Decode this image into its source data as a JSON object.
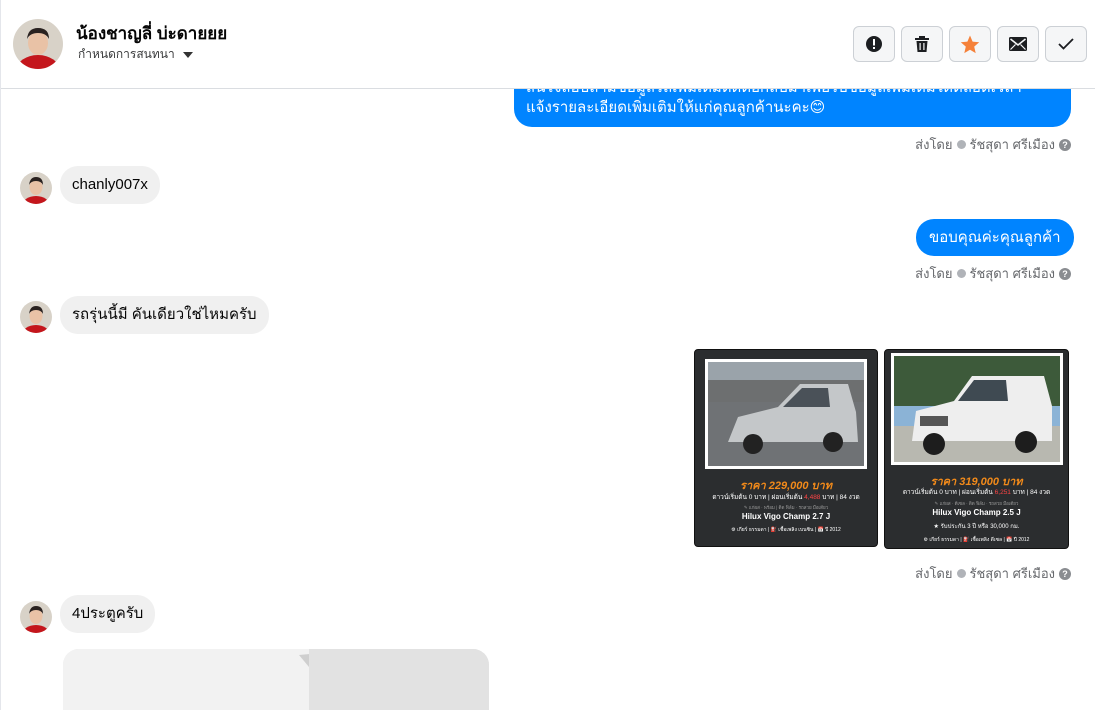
{
  "header": {
    "contact_name": "น้องชาญลี่ บ่ะดายยย",
    "assign_label": "กำหนดการสนทนา",
    "actions": [
      {
        "name": "spam-report-button",
        "icon": "exclamation-icon"
      },
      {
        "name": "delete-button",
        "icon": "trash-icon"
      },
      {
        "name": "star-button",
        "icon": "star-icon"
      },
      {
        "name": "mark-unread-button",
        "icon": "envelope-icon"
      },
      {
        "name": "mark-done-button",
        "icon": "check-icon"
      }
    ],
    "star_color": "#f5813a"
  },
  "messages": {
    "out_1": {
      "line1": "สนใจสอบถามขอมูลรถเพิ่มเติมติดตอกลับมาเพื่อรับขอมูลเพิ่มเติมไดตลอดเวลา",
      "line2": "แจ้งรายละเอียดเพิ่มเติมให้แก่คุณลูกค้านะคะ😊",
      "sent_by_label": "ส่งโดย",
      "sender": "รัชสุดา ศรีเมือง"
    },
    "in_1": "chanly007x",
    "out_2": {
      "text": "ขอบคุณค่ะคุณลูกค้า",
      "sent_by_label": "ส่งโดย",
      "sender": "รัชสุดา ศรีเมือง"
    },
    "in_2": "รถรุ่นนี้มี คันเดียวใช่ไหมครับ",
    "cards": [
      {
        "price": "ราคา 229,000 บาท",
        "terms_a": "ดาวน์เริ่มต้น 0 บาท | ผ่อนเริ่มต้น ",
        "terms_red": "4,488",
        "terms_b": " บาท | 84 งวด",
        "small": "✎ แก่ผส · พร้อม | ติด ฟิล์ม · รถสวย มือเดียว",
        "model": "Hilux Vigo Champ 2.7 J",
        "extra": "",
        "footer": "⚙ เกียร์ ธรรมดา  |  ⛽ เชื้อเพลิง เบนซิน  |  📅 ปี 2012"
      },
      {
        "price": "ราคา 319,000 บาท",
        "terms_a": "ดาวน์เริ่มต้น 0 บาท | ผ่อนเริ่มต้น ",
        "terms_red": "6,251",
        "terms_b": " บาท | 84 งวด",
        "small": "✎ แก่ผส · ดีเซล · ติด ฟิล์ม · รถสวย มือเดียว",
        "model": "Hilux Vigo Champ 2.5 J",
        "extra": "★ รับประกัน 3 ปี หรือ 30,000 กม.",
        "footer": "⚙ เกียร์ ธรรมดา  |  ⛽ เชื้อเพลิง ดีเซล  |  📅 ปี 2012"
      }
    ],
    "cards_meta": {
      "sent_by_label": "ส่งโดย",
      "sender": "รัชสุดา ศรีเมือง"
    },
    "in_3": "4ประตูครับ"
  },
  "colors": {
    "outgoing_bubble": "#0084ff",
    "incoming_bubble": "#f0f0f0",
    "price": "#f28a1a"
  }
}
